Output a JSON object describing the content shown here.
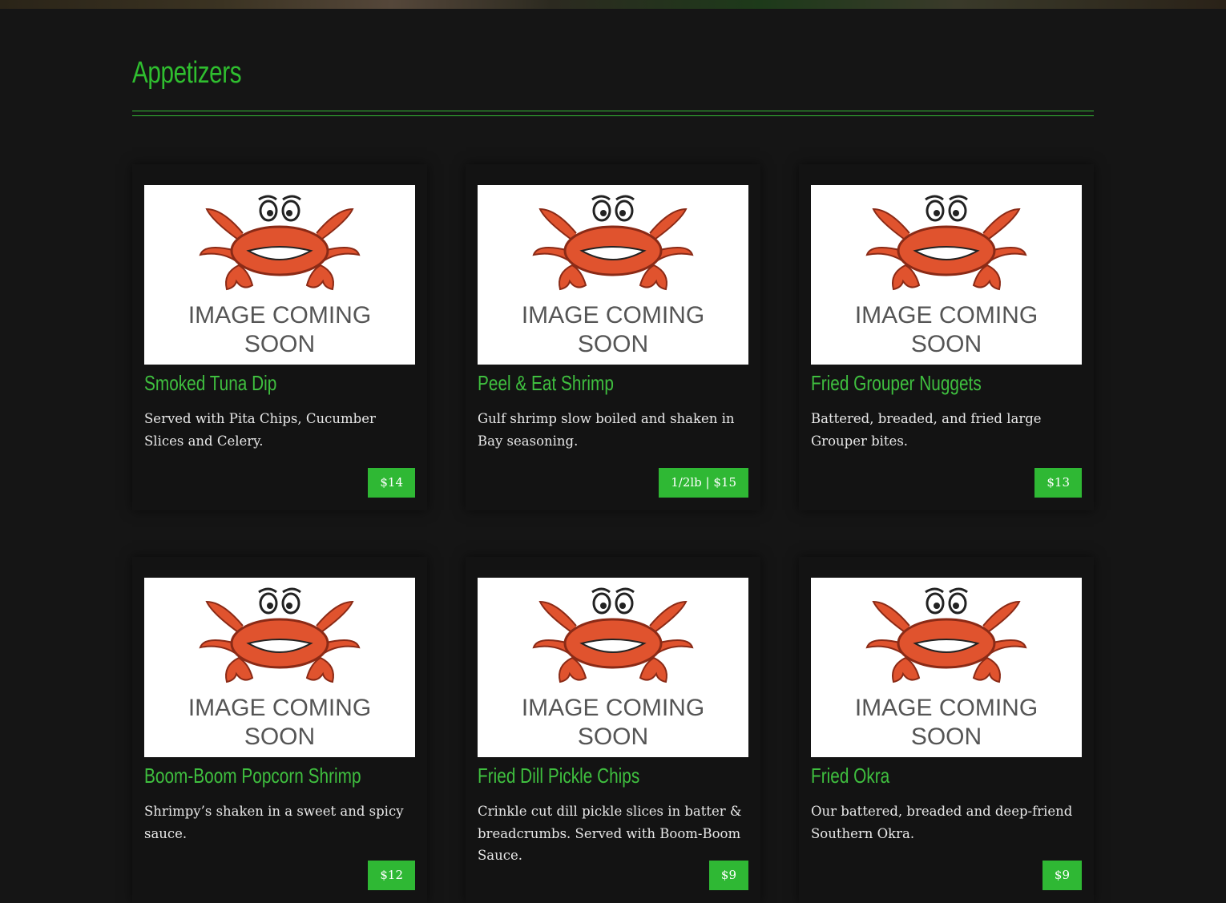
{
  "section": {
    "title": "Appetizers"
  },
  "placeholder": {
    "line1": "IMAGE COMING",
    "line2": "SOON"
  },
  "colors": {
    "accent": "#2fbe2f",
    "background": "#151515",
    "price_bg": "#2fb834",
    "crab": "#d94a2b"
  },
  "items": [
    {
      "name": "Smoked Tuna Dip",
      "description": "Served with Pita Chips, Cucumber Slices and Celery.",
      "price": "$14"
    },
    {
      "name": "Peel & Eat Shrimp",
      "description": "Gulf shrimp slow boiled and shaken in Bay seasoning.",
      "price": "1/2lb | $15"
    },
    {
      "name": "Fried Grouper Nuggets",
      "description": "Battered, breaded, and fried large Grouper bites.",
      "price": "$13"
    },
    {
      "name": "Boom-Boom Popcorn Shrimp",
      "description": "Shrimpy’s shaken in a sweet and spicy sauce.",
      "price": "$12"
    },
    {
      "name": "Fried Dill Pickle Chips",
      "description": "Crinkle cut dill pickle slices in batter & breadcrumbs. Served with Boom-Boom Sauce.",
      "price": "$9"
    },
    {
      "name": "Fried Okra",
      "description": "Our battered, breaded and deep-friend Southern Okra.",
      "price": "$9"
    }
  ]
}
